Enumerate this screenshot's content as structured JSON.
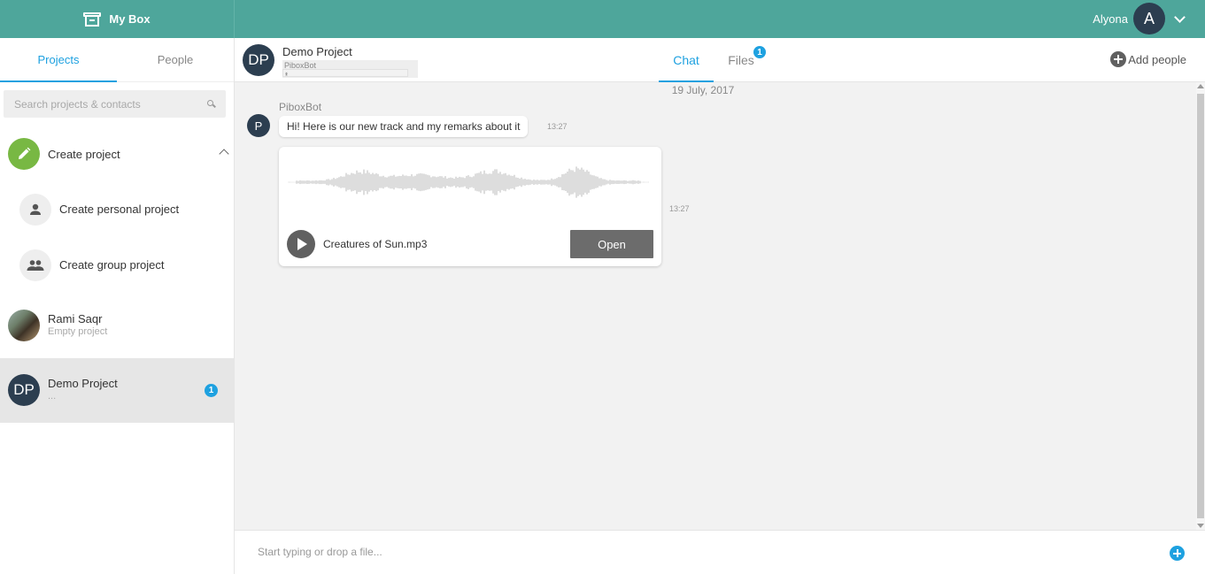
{
  "app": {
    "title": "My Box",
    "user_name": "Alyona",
    "user_initial": "A",
    "accent_color": "#4ea69b",
    "link_color": "#1ea1e0"
  },
  "sidebar": {
    "tabs": [
      {
        "label": "Projects",
        "active": true
      },
      {
        "label": "People",
        "active": false
      }
    ],
    "search_placeholder": "Search projects & contacts",
    "create_label": "Create project",
    "create_options": [
      {
        "label": "Create personal project",
        "icon": "person-icon"
      },
      {
        "label": "Create group project",
        "icon": "group-icon"
      }
    ],
    "projects": [
      {
        "name": "Rami Saqr",
        "subtitle": "Empty project",
        "avatar": "photo"
      },
      {
        "name": "Demo Project",
        "subtitle": "...",
        "initials": "DP",
        "badge": "1",
        "selected": true
      }
    ]
  },
  "header": {
    "initials": "DP",
    "title": "Demo Project",
    "subtitle": "PiboxBot",
    "tabs": [
      {
        "label": "Chat",
        "active": true
      },
      {
        "label": "Files",
        "active": false,
        "badge": "1"
      }
    ],
    "add_people_label": "Add people"
  },
  "chat": {
    "date": "19 July, 2017",
    "messages": [
      {
        "sender": "PiboxBot",
        "avatar_initial": "P",
        "text": "Hi! Here is our new track and my remarks about it",
        "time": "13:27"
      },
      {
        "type": "audio",
        "file_name": "Creatures of Sun.mp3",
        "open_label": "Open",
        "time": "13:27"
      }
    ]
  },
  "composer": {
    "placeholder": "Start typing or drop a file..."
  }
}
